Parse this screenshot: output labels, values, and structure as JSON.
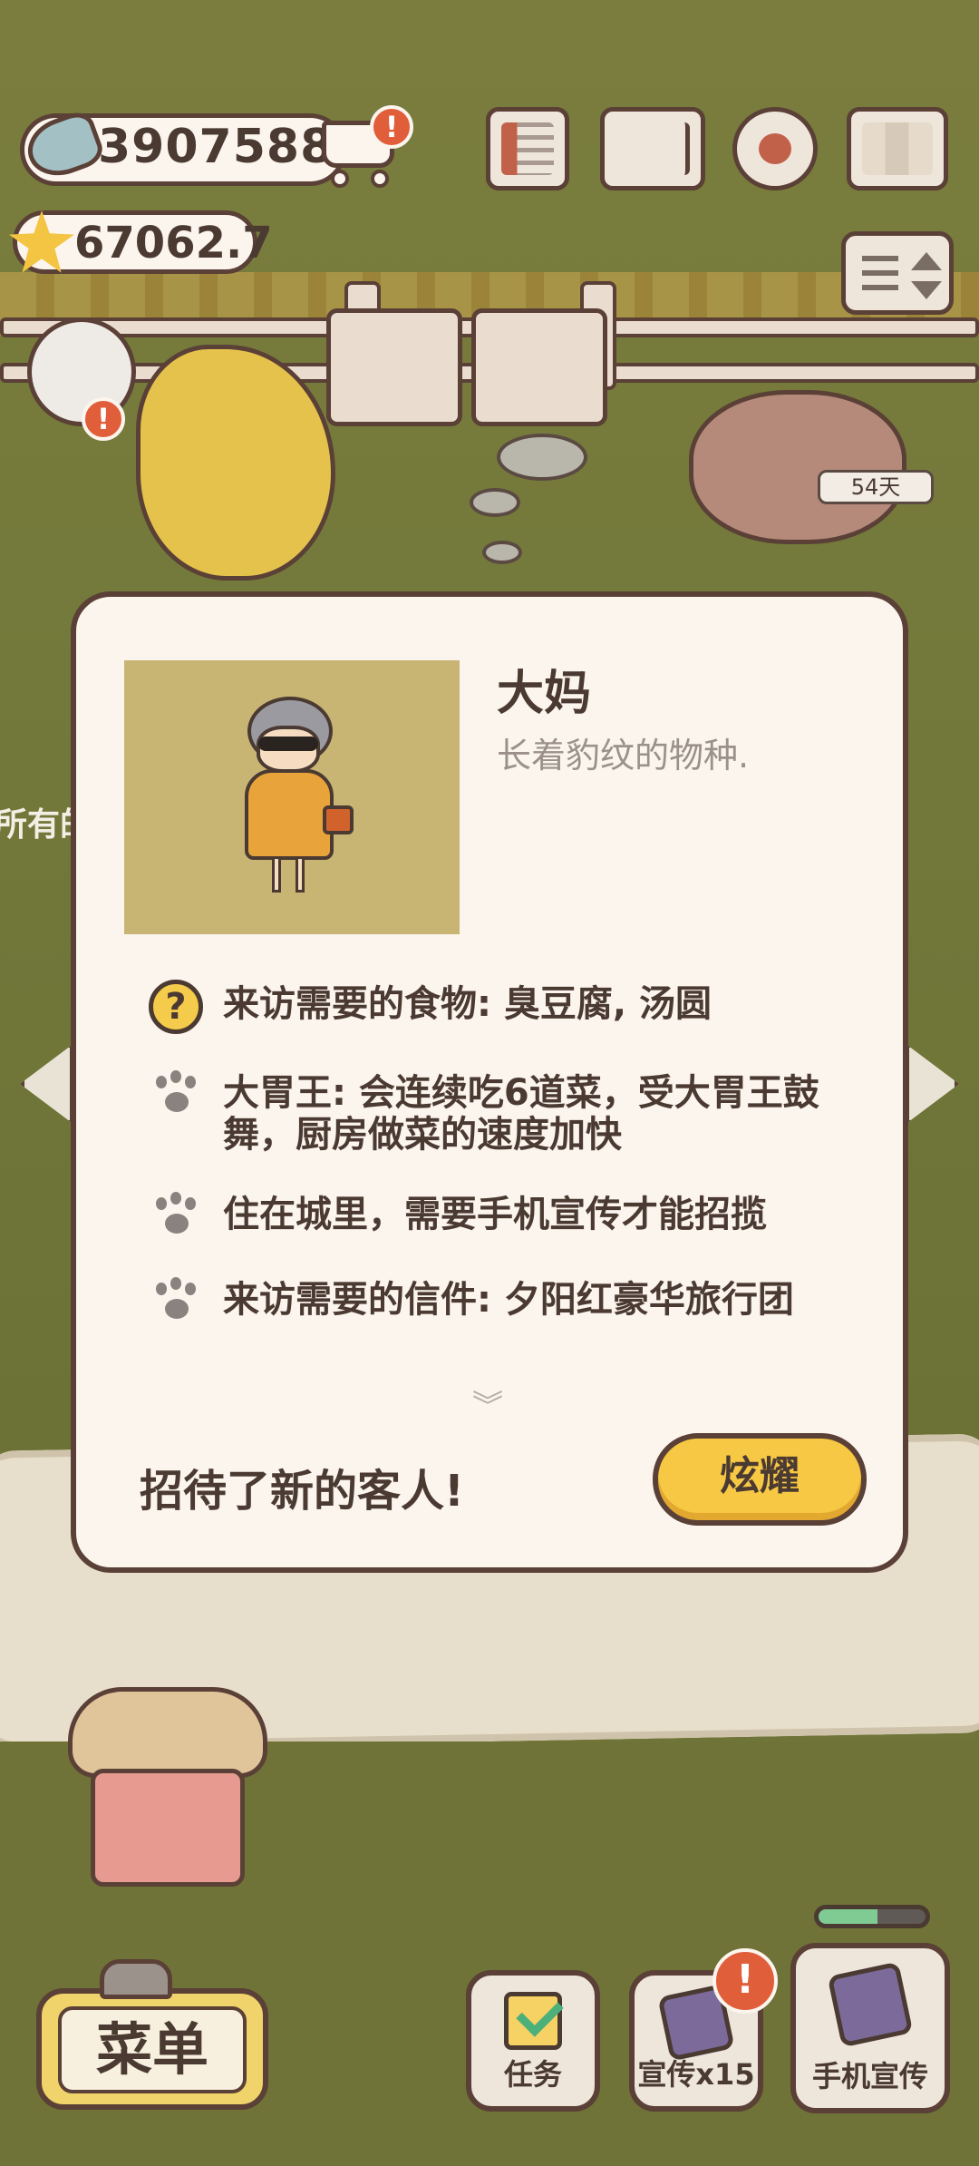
{
  "hud": {
    "fish_count": "3907588",
    "star_count": "67062.7",
    "icons": [
      "fish-icon",
      "cart-icon",
      "newspaper-icon",
      "book-icon",
      "gear-icon",
      "map-icon",
      "sort-icon"
    ],
    "alert_mark": "!"
  },
  "scene": {
    "days_badge": "54天",
    "left_edge_text": "所有的",
    "cat_alert": "!"
  },
  "guest_card": {
    "name": "大妈",
    "description": "长着豹纹的物种.",
    "traits": [
      {
        "icon": "question-icon",
        "glyph": "?",
        "text": "来访需要的食物: 臭豆腐, 汤圆"
      },
      {
        "icon": "paw-icon",
        "text": "大胃王: 会连续吃6道菜，受大胃王鼓舞，厨房做菜的速度加快"
      },
      {
        "icon": "paw-icon",
        "text": "住在城里，需要手机宣传才能招揽"
      },
      {
        "icon": "paw-icon",
        "text": "来访需要的信件: 夕阳红豪华旅行团"
      }
    ],
    "more_glyph": "︾",
    "new_guest_text": "招待了新的客人!",
    "show_button": "炫耀"
  },
  "bottom_bar": {
    "menu_label": "菜单",
    "task_label": "任务",
    "promo_label": "宣传x15",
    "promo_alert": "!",
    "phone_promo_label": "手机宣传",
    "phone_promo_progress": 0.55
  },
  "colors": {
    "accent_yellow": "#f7c843",
    "alert_red": "#e15e3a",
    "outline": "#5a4036",
    "card_bg": "#fbf5ee",
    "progress_green": "#7fcb93"
  }
}
